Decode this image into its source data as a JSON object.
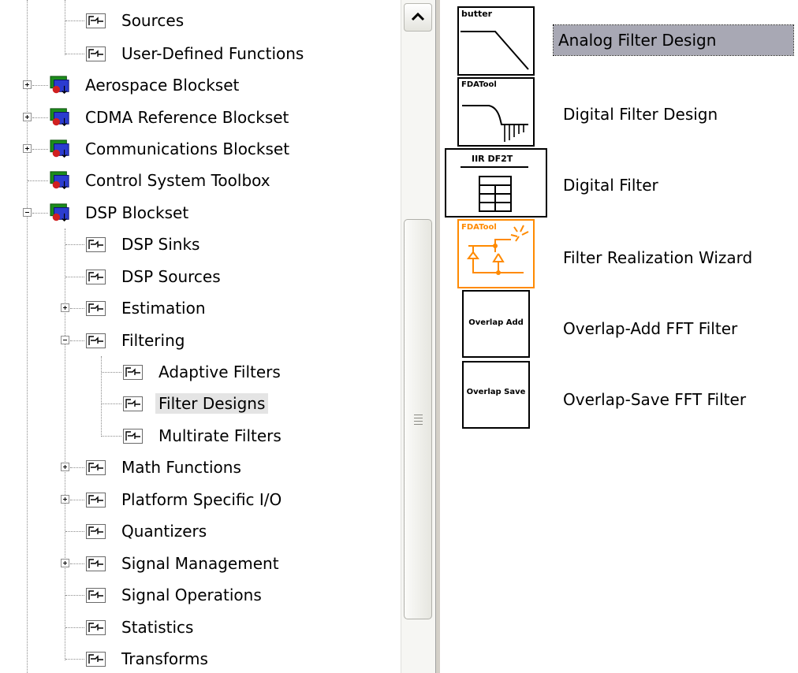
{
  "tree": {
    "items": [
      {
        "label": "Sources",
        "type": "block"
      },
      {
        "label": "User-Defined Functions",
        "type": "block"
      },
      {
        "label": "Aerospace Blockset",
        "type": "library",
        "expander": "plus"
      },
      {
        "label": "CDMA Reference Blockset",
        "type": "library",
        "expander": "plus"
      },
      {
        "label": "Communications Blockset",
        "type": "library",
        "expander": "plus"
      },
      {
        "label": "Control System Toolbox",
        "type": "library"
      },
      {
        "label": "DSP Blockset",
        "type": "library",
        "expander": "minus"
      },
      {
        "label": "DSP Sinks",
        "type": "block"
      },
      {
        "label": "DSP Sources",
        "type": "block"
      },
      {
        "label": "Estimation",
        "type": "block",
        "expander": "plus"
      },
      {
        "label": "Filtering",
        "type": "block",
        "expander": "minus"
      },
      {
        "label": "Adaptive Filters",
        "type": "block"
      },
      {
        "label": "Filter Designs",
        "type": "block",
        "selected": true
      },
      {
        "label": "Multirate Filters",
        "type": "block"
      },
      {
        "label": "Math Functions",
        "type": "block",
        "expander": "plus"
      },
      {
        "label": "Platform Specific I/O",
        "type": "block",
        "expander": "plus"
      },
      {
        "label": "Quantizers",
        "type": "block"
      },
      {
        "label": "Signal Management",
        "type": "block",
        "expander": "plus"
      },
      {
        "label": "Signal Operations",
        "type": "block"
      },
      {
        "label": "Statistics",
        "type": "block"
      },
      {
        "label": "Transforms",
        "type": "block"
      }
    ]
  },
  "blocks": {
    "items": [
      {
        "label": "Analog Filter Design",
        "icon": "butter",
        "icon_text": "butter",
        "selected": true
      },
      {
        "label": "Digital Filter Design",
        "icon": "fdatool",
        "icon_text": "FDATool"
      },
      {
        "label": "Digital Filter",
        "icon": "iir-df2t",
        "icon_text": "IIR DF2T"
      },
      {
        "label": "Filter Realization Wizard",
        "icon": "fdatool-wizard",
        "icon_text": "FDATool"
      },
      {
        "label": "Overlap-Add FFT Filter",
        "icon": "overlap-add",
        "icon_text": "Overlap Add"
      },
      {
        "label": "Overlap-Save FFT Filter",
        "icon": "overlap-save",
        "icon_text": "Overlap Save"
      }
    ]
  },
  "colors": {
    "selection_tree": "#e4e4e4",
    "selection_list": "#a8a8b4",
    "wizard_accent": "#ff8a00"
  }
}
